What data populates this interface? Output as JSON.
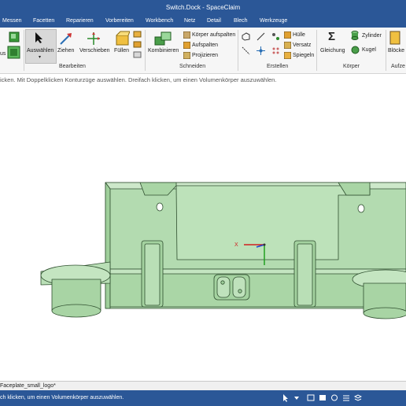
{
  "window": {
    "title": "Switch.Dock - SpaceClaim"
  },
  "menu": [
    "Messen",
    "Facetten",
    "Reparieren",
    "Vorbereiten",
    "Workbench",
    "Netz",
    "Detail",
    "Blech",
    "Werkzeuge"
  ],
  "ribbon": {
    "groups": {
      "bearbeiten": "Bearbeiten",
      "schneiden": "Schneiden",
      "erstellen": "Erstellen",
      "koerper": "Körper",
      "aufze": "Aufze"
    },
    "buttons": {
      "partial_left": "us",
      "auswaehlen": "Auswählen",
      "ziehen": "Ziehen",
      "verschieben": "Verschieben",
      "fuellen": "Füllen",
      "kombinieren": "Kombinieren",
      "koerper_aufspalten": "Körper aufspalten",
      "aufspalten": "Aufspalten",
      "projizieren": "Projizieren",
      "huelle": "Hülle",
      "versatz": "Versatz",
      "spiegeln": "Spiegeln",
      "gleichung": "Gleichung",
      "zylinder": "Zylinder",
      "kugel": "Kugel",
      "bloecke": "Blöcke"
    }
  },
  "hint": "icken. Mit Doppelklicken Konturzüge auswählen. Dreifach klicken, um einen Volumenkörper auszuwählen.",
  "axis": {
    "x_label": "X"
  },
  "document_tab": "Faceplate_small_logo*",
  "status": {
    "text": "ch klicken, um einen Volumenkörper auszuwählen."
  },
  "colors": {
    "title_bar": "#2b5797",
    "ribbon_bg": "#f6f6f6",
    "model_fill": "#b3dbb0",
    "model_edge": "#2f4f2f",
    "status_bar": "#2b5797"
  }
}
